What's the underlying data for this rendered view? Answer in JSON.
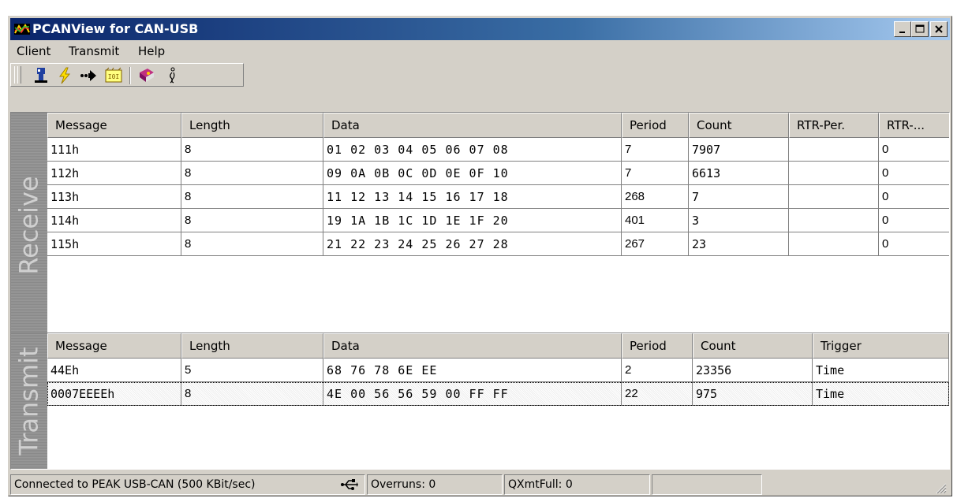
{
  "window": {
    "title": "PCANView for CAN-USB"
  },
  "menu": [
    "Client",
    "Transmit",
    "Help"
  ],
  "toolbar": {
    "buttons": [
      "connect-icon",
      "lightning-icon",
      "transmit-arrow-icon",
      "filter-icon",
      "book-icon",
      "info-icon"
    ]
  },
  "receive": {
    "tab_label": "Receive",
    "columns": [
      "Message",
      "Length",
      "Data",
      "Period",
      "Count",
      "RTR-Per.",
      "RTR-..."
    ],
    "rows": [
      [
        "111h",
        "8",
        "01 02 03 04 05 06 07 08",
        "7",
        "7907",
        "",
        "0"
      ],
      [
        "112h",
        "8",
        "09 0A 0B 0C 0D 0E 0F 10",
        "7",
        "6613",
        "",
        "0"
      ],
      [
        "113h",
        "8",
        "11 12 13 14 15 16 17 18",
        "268",
        "7",
        "",
        "0"
      ],
      [
        "114h",
        "8",
        "19 1A 1B 1C 1D 1E 1F 20",
        "401",
        "3",
        "",
        "0"
      ],
      [
        "115h",
        "8",
        "21 22 23 24 25 26 27 28",
        "267",
        "23",
        "",
        "0"
      ]
    ]
  },
  "transmit": {
    "tab_label": "Transmit",
    "columns": [
      "Message",
      "Length",
      "Data",
      "Period",
      "Count",
      "Trigger"
    ],
    "rows": [
      [
        "44Eh",
        "5",
        "68 76 78 6E EE",
        "2",
        "23356",
        "Time"
      ],
      [
        "0007EEEEh",
        "8",
        "4E 00 56 56 59 00 FF FF",
        "22",
        "975",
        "Time"
      ]
    ],
    "selected_row": 1
  },
  "status": {
    "connection": "Connected to PEAK USB-CAN (500 KBit/sec)",
    "overruns": "Overruns: 0",
    "qxmtfull": "QXmtFull: 0",
    "extra": ""
  },
  "colors": {
    "titlebar_start": "#0a246a",
    "titlebar_end": "#a6caf0",
    "face": "#d4d0c8"
  }
}
